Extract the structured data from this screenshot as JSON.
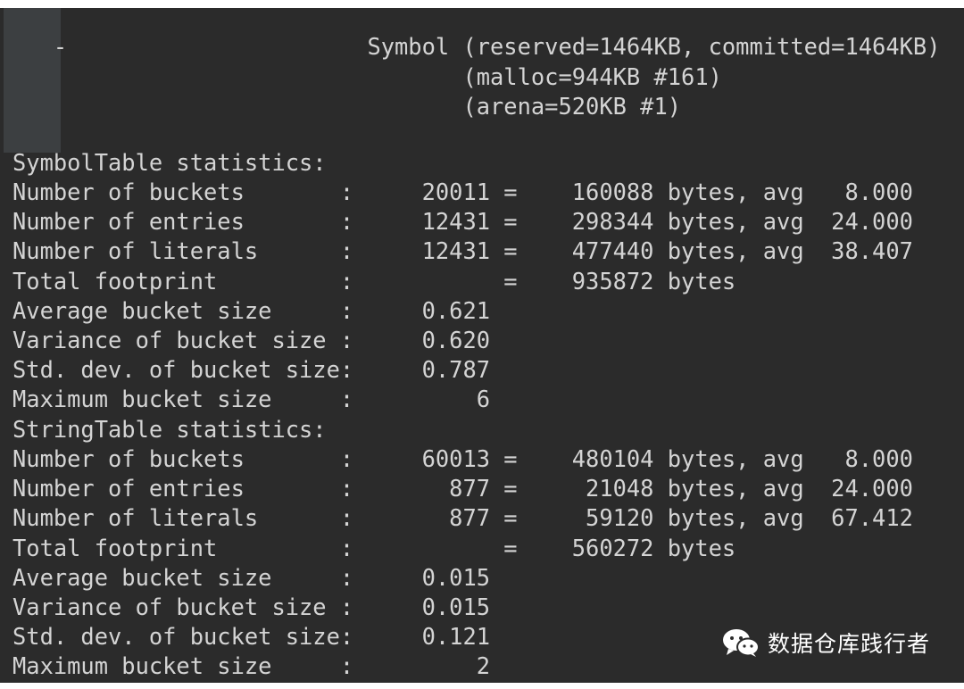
{
  "terminal": {
    "lines": [
      "   -                      Symbol (reserved=1464KB, committed=1464KB)",
      "                                 (malloc=944KB #161)",
      "                                 (arena=520KB #1)",
      "SymbolTable statistics:",
      "Number of buckets       :     20011 =    160088 bytes, avg   8.000",
      "Number of entries       :     12431 =    298344 bytes, avg  24.000",
      "Number of literals      :     12431 =    477440 bytes, avg  38.407",
      "Total footprint         :           =    935872 bytes",
      "Average bucket size     :     0.621",
      "Variance of bucket size :     0.620",
      "Std. dev. of bucket size:     0.787",
      "Maximum bucket size     :         6",
      "StringTable statistics:",
      "Number of buckets       :     60013 =    480104 bytes, avg   8.000",
      "Number of entries       :       877 =     21048 bytes, avg  24.000",
      "Number of literals      :       877 =     59120 bytes, avg  67.412",
      "Total footprint         :           =    560272 bytes",
      "Average bucket size     :     0.015",
      "Variance of bucket size :     0.015",
      "Std. dev. of bucket size:     0.121",
      "Maximum bucket size     :         2"
    ]
  },
  "watermark": {
    "text": "数据仓库践行者",
    "icon": "wechat-icon"
  },
  "colors": {
    "background": "#2b2b2b",
    "gutter": "#3c3f41",
    "text": "#d4d4d4"
  }
}
